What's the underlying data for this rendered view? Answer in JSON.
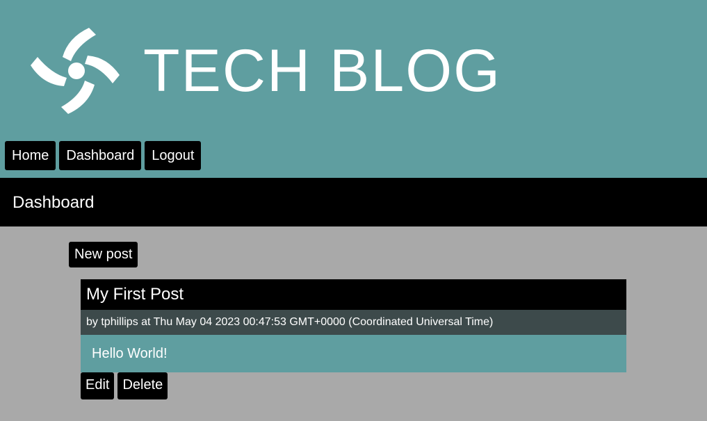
{
  "colors": {
    "header_bg": "#5f9ea0",
    "page_bg": "#a9a9a9",
    "bar_bg": "#000000",
    "meta_bg": "#3d4a4b",
    "text": "#ffffff"
  },
  "header": {
    "logo_icon": "swirl-logo-icon",
    "brand": "TECH BLOG"
  },
  "nav": {
    "items": [
      {
        "label": "Home"
      },
      {
        "label": "Dashboard"
      },
      {
        "label": "Logout"
      }
    ]
  },
  "page": {
    "title": "Dashboard"
  },
  "dashboard": {
    "new_post_label": "New post",
    "posts": [
      {
        "title": "My First Post",
        "meta": "by tphillips at Thu May 04 2023 00:47:53 GMT+0000 (Coordinated Universal Time)",
        "body": "Hello World!",
        "edit_label": "Edit",
        "delete_label": "Delete"
      }
    ]
  }
}
